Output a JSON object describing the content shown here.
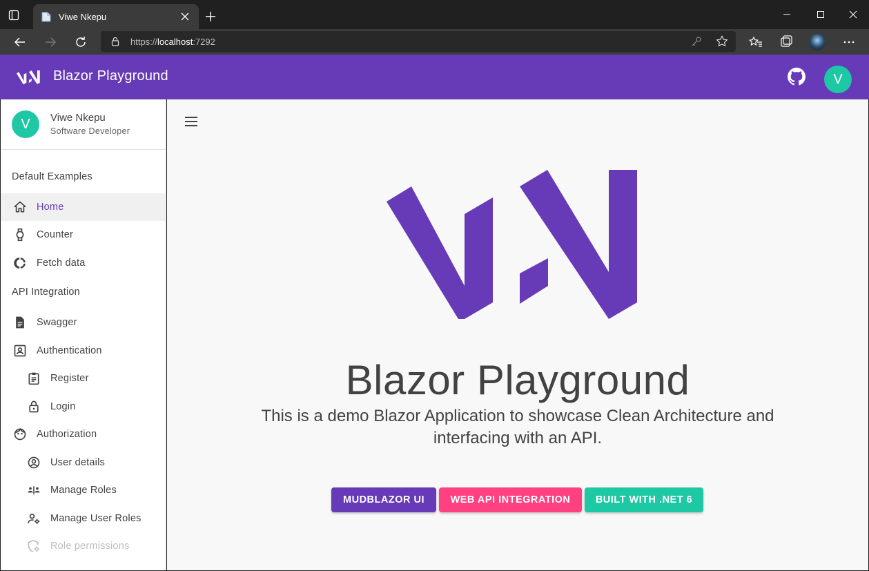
{
  "browser": {
    "tab_title": "Viwe Nkepu",
    "url_scheme": "https://",
    "url_host": "localhost",
    "url_port": ":7292"
  },
  "appbar": {
    "title": "Blazor Playground",
    "avatar_initial": "V",
    "color": "#673ab7"
  },
  "sidebar": {
    "profile": {
      "initial": "V",
      "name": "Viwe Nkepu",
      "role": "Software Developer"
    },
    "sections": [
      {
        "label": "Default Examples",
        "items": [
          {
            "label": "Home",
            "icon": "home-icon",
            "active": true
          },
          {
            "label": "Counter",
            "icon": "watch-icon"
          },
          {
            "label": "Fetch data",
            "icon": "donut-chart-icon"
          }
        ]
      },
      {
        "label": "API Integration",
        "items": [
          {
            "label": "Swagger",
            "icon": "document-icon"
          },
          {
            "label": "Authentication",
            "icon": "contact-card-icon"
          },
          {
            "label": "Register",
            "icon": "clipboard-icon"
          },
          {
            "label": "Login",
            "icon": "lock-icon"
          },
          {
            "label": "Authorization",
            "icon": "face-icon"
          },
          {
            "label": "User details",
            "icon": "account-circle-icon"
          },
          {
            "label": "Manage Roles",
            "icon": "people-icon"
          },
          {
            "label": "Manage User Roles",
            "icon": "manage-accounts-icon"
          },
          {
            "label": "Role permissions",
            "icon": "shield-gear-icon",
            "disabled": true
          }
        ]
      }
    ]
  },
  "main": {
    "title": "Blazor Playground",
    "subtitle": "This is a demo Blazor Application to showcase Clean Architecture and interfacing with an API.",
    "buttons": [
      {
        "label": "MUDBLAZOR UI",
        "color": "#673ab7"
      },
      {
        "label": "WEB API INTEGRATION",
        "color": "#ff4081"
      },
      {
        "label": "BUILT WITH .NET 6",
        "color": "#1ec8a5"
      }
    ]
  }
}
